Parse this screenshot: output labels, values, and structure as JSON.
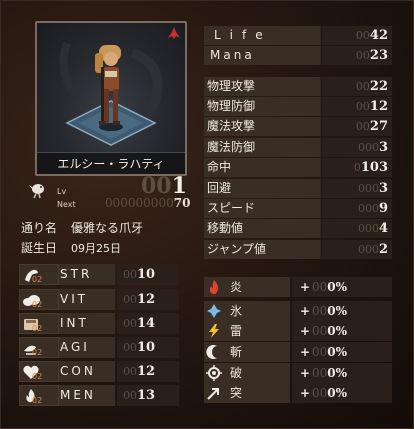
{
  "character": {
    "name": "エルシー・ラハティ",
    "level_zeros": "00",
    "level": "1",
    "lv_label": "Lv",
    "next_label": "Next",
    "next_zeros": "000000000",
    "next_value": "70",
    "alias_label": "通り名",
    "alias": "優雅なる爪牙",
    "birthday_label": "誕生日",
    "birthday": "09月25日"
  },
  "vitals": [
    {
      "label": "Life",
      "zeros": "00",
      "value": "42"
    },
    {
      "label": "Mana",
      "zeros": "00",
      "value": "23"
    }
  ],
  "combat": [
    {
      "label": "物理攻撃",
      "zeros": "00",
      "value": "22"
    },
    {
      "label": "物理防御",
      "zeros": "00",
      "value": "12"
    },
    {
      "label": "魔法攻撃",
      "zeros": "00",
      "value": "27"
    },
    {
      "label": "魔法防御",
      "zeros": "000",
      "value": "3"
    },
    {
      "label": "命中",
      "zeros": "0",
      "value": "103"
    },
    {
      "label": "回避",
      "zeros": "000",
      "value": "3"
    },
    {
      "label": "スピード",
      "zeros": "000",
      "value": "9"
    },
    {
      "label": "移動値",
      "zeros": "000",
      "value": "4"
    },
    {
      "label": "ジャンプ値",
      "zeros": "000",
      "value": "2"
    }
  ],
  "stats": [
    {
      "name": "STR",
      "lv": "02",
      "zeros": "00",
      "value": "10",
      "icon": "arm-icon"
    },
    {
      "name": "VIT",
      "lv": "02",
      "zeros": "00",
      "value": "12",
      "icon": "cloud-icon"
    },
    {
      "name": "INT",
      "lv": "02",
      "zeros": "00",
      "value": "14",
      "icon": "book-icon"
    },
    {
      "name": "AGI",
      "lv": "02",
      "zeros": "00",
      "value": "10",
      "icon": "wind-icon"
    },
    {
      "name": "CON",
      "lv": "02",
      "zeros": "00",
      "value": "12",
      "icon": "heart-icon"
    },
    {
      "name": "MEN",
      "lv": "02",
      "zeros": "00",
      "value": "13",
      "icon": "flame-icon"
    }
  ],
  "elements": [
    {
      "name": "炎",
      "sign": "+",
      "zeros": "00",
      "value": "0%",
      "icon": "fire-icon",
      "color": "#e0422a"
    },
    {
      "name": "氷",
      "sign": "+",
      "zeros": "00",
      "value": "0%",
      "icon": "ice-icon",
      "color": "#7ab8e8"
    },
    {
      "name": "雷",
      "sign": "+",
      "zeros": "00",
      "value": "0%",
      "icon": "lightning-icon",
      "color": "#f0c030"
    },
    {
      "name": "斬",
      "sign": "+",
      "zeros": "00",
      "value": "0%",
      "icon": "crescent-icon",
      "color": "#f0ece6"
    },
    {
      "name": "破",
      "sign": "+",
      "zeros": "00",
      "value": "0%",
      "icon": "burst-icon",
      "color": "#f0ece6"
    },
    {
      "name": "突",
      "sign": "+",
      "zeros": "00",
      "value": "0%",
      "icon": "arrow-icon",
      "color": "#f0ece6"
    }
  ]
}
